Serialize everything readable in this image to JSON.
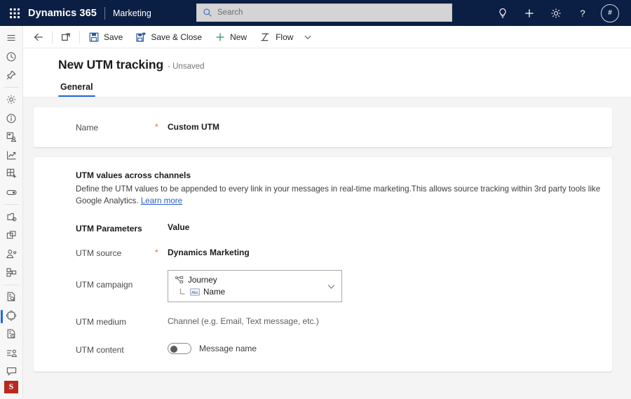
{
  "topbar": {
    "waffle_icon": "waffle-grid-icon",
    "brand": "Dynamics 365",
    "app_name": "Marketing",
    "search": {
      "icon": "search-icon",
      "placeholder": "Search",
      "value": ""
    },
    "actions": [
      {
        "name": "lightbulb-icon",
        "label": "Insights"
      },
      {
        "name": "plus-icon",
        "label": "Quick create"
      },
      {
        "name": "gear-icon",
        "label": "Settings"
      },
      {
        "name": "question-icon",
        "label": "Help"
      }
    ],
    "avatar_initials": "#"
  },
  "rail": {
    "items": [
      {
        "name": "hamburger-icon",
        "label": "Show site map"
      },
      {
        "name": "clock-icon",
        "label": "Recent"
      },
      {
        "name": "pin-icon",
        "label": "Pinned"
      },
      {
        "name": "gear-icon",
        "label": "Overview"
      },
      {
        "name": "info-icon",
        "label": "Information"
      },
      {
        "name": "segment-person-icon",
        "label": "Segments"
      },
      {
        "name": "line-chart-icon",
        "label": "Analytics"
      },
      {
        "name": "grid-plus-icon",
        "label": "Forms"
      },
      {
        "name": "toggle-pill-icon",
        "label": "Settings toggle"
      },
      {
        "name": "clipboard-gear-icon",
        "label": "Journeys"
      },
      {
        "name": "copy-pages-icon",
        "label": "Assets"
      },
      {
        "name": "person-heart-icon",
        "label": "Customers"
      },
      {
        "name": "nodes-plus-icon",
        "label": "Channels"
      },
      {
        "name": "document-search-icon",
        "label": "Templates"
      },
      {
        "name": "puzzle-icon",
        "label": "UTM tracking"
      },
      {
        "name": "document-clock-icon",
        "label": "Scheduled"
      },
      {
        "name": "list-person-icon",
        "label": "Subscriptions"
      },
      {
        "name": "chat-icon",
        "label": "Messages"
      }
    ],
    "selected_index": 14,
    "badge": "S"
  },
  "commandbar": {
    "buttons": [
      {
        "name": "back-button",
        "icon": "arrow-left-icon",
        "label": ""
      },
      {
        "name": "popout-button",
        "icon": "open-new-window-icon",
        "label": ""
      },
      {
        "name": "save-button",
        "icon": "save-disk-icon",
        "label": "Save"
      },
      {
        "name": "save-close-button",
        "icon": "save-close-icon",
        "label": "Save & Close"
      },
      {
        "name": "new-button",
        "icon": "plus-icon",
        "label": "New"
      },
      {
        "name": "flow-button",
        "icon": "flow-icon",
        "label": "Flow"
      }
    ],
    "flow_chevron": "chevron-down-icon"
  },
  "page": {
    "title": "New UTM tracking",
    "subtitle": "- Unsaved",
    "tabs": [
      {
        "label": "General",
        "active": true
      }
    ]
  },
  "name_card": {
    "label": "Name",
    "required_marker": "*",
    "value": "Custom UTM"
  },
  "utm_card": {
    "heading": "UTM values across channels",
    "description_part1": "Define the UTM values to be appended to every link in your messages in real-time marketing.This allows source tracking within 3rd party tools like Google Analytics. ",
    "learn_more": "Learn more",
    "table": {
      "col_parameter": "UTM Parameters",
      "col_value": "Value",
      "rows": [
        {
          "name": "utm-source-row",
          "label": "UTM source",
          "required_marker": "*",
          "type": "text-bold",
          "value": "Dynamics Marketing"
        },
        {
          "name": "utm-campaign-row",
          "label": "UTM campaign",
          "required_marker": "",
          "type": "combo",
          "combo": {
            "token_primary": "Journey",
            "token_primary_icon": "journey-flow-icon",
            "token_secondary": "Name",
            "token_secondary_icon": "abc-text-icon",
            "chevron": "chevron-down-icon"
          }
        },
        {
          "name": "utm-medium-row",
          "label": "UTM medium",
          "required_marker": "",
          "type": "text",
          "value": "Channel (e.g. Email, Text message, etc.)"
        },
        {
          "name": "utm-content-row",
          "label": "UTM content",
          "required_marker": "",
          "type": "toggle",
          "toggle_state": "off",
          "value": "Message name"
        }
      ]
    }
  },
  "colors": {
    "navy": "#0b1f44",
    "accent_blue": "#2266dd",
    "required_red": "#e8624a",
    "link_blue": "#2a5fc9",
    "canvas_gray": "#f4f4f4",
    "badge_red": "#b8291f"
  }
}
